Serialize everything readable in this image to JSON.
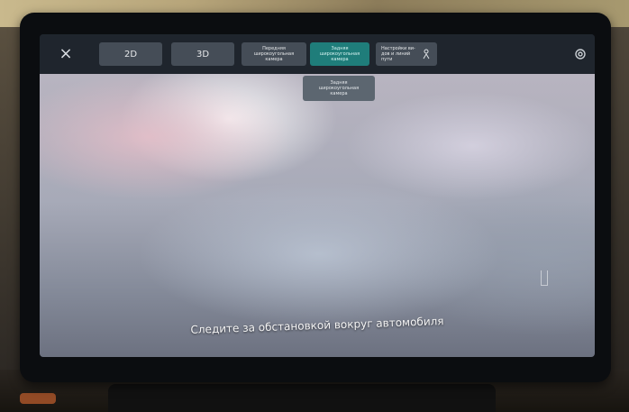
{
  "toolbar": {
    "close_label": "×",
    "btn_2d": "2D",
    "btn_3d": "3D",
    "btn_front": "Передняя\nшироко­угольная\nкамера",
    "btn_side": "Задняя\nширокоугольная\nкамера",
    "btn_guide": "Настройки ви-\nдов и линий\nпути"
  },
  "tooltip": {
    "text": "Задняя\nширокоугольная\nкамера"
  },
  "camera": {
    "caption": "Следите за обстановкой вокруг автомобиля"
  },
  "icons": {
    "close": "close-icon",
    "person": "person-icon",
    "settings": "settings-icon"
  },
  "colors": {
    "topbar": "#1f252d",
    "button": "#454d57",
    "active_button": "#1f7d7a"
  }
}
